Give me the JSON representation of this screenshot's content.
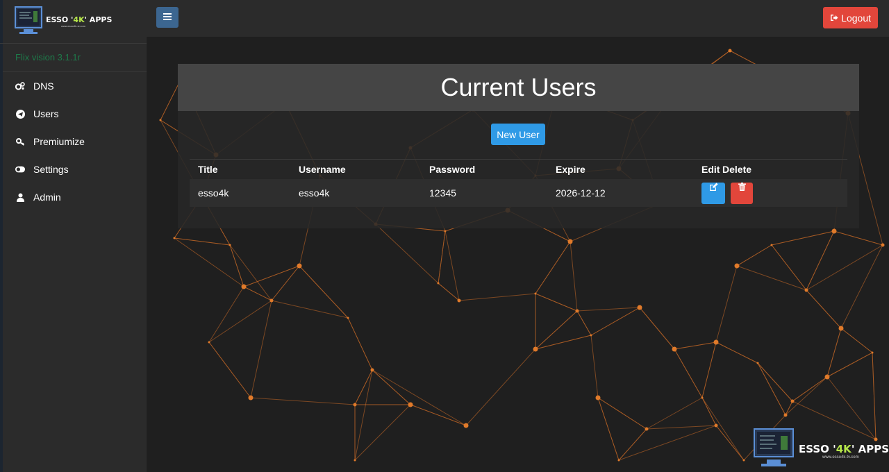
{
  "brand": {
    "name_pre": "ESSO '",
    "name_hl": "4K",
    "name_post": "' APPS",
    "url": "www.esso4k-tv.com"
  },
  "sidebar": {
    "version": "Flix vision 3.1.1r",
    "items": [
      {
        "label": "DNS",
        "icon": "cogs-icon"
      },
      {
        "label": "Users",
        "icon": "telegram-icon"
      },
      {
        "label": "Premiumize",
        "icon": "key-icon"
      },
      {
        "label": "Settings",
        "icon": "toggle-icon"
      },
      {
        "label": "Admin",
        "icon": "user-icon"
      }
    ]
  },
  "header": {
    "logout_label": "Logout"
  },
  "main": {
    "title": "Current Users",
    "new_user_label": "New User",
    "columns": [
      "Title",
      "Username",
      "Password",
      "Expire",
      "Edit",
      "Delete"
    ],
    "rows": [
      {
        "title": "esso4k",
        "username": "esso4k",
        "password": "12345",
        "expire": "2026-12-12"
      }
    ]
  },
  "colors": {
    "accent": "#2f9ae6",
    "danger": "#e2463b",
    "network": "#e07a2a",
    "version": "#1e7a4a"
  }
}
